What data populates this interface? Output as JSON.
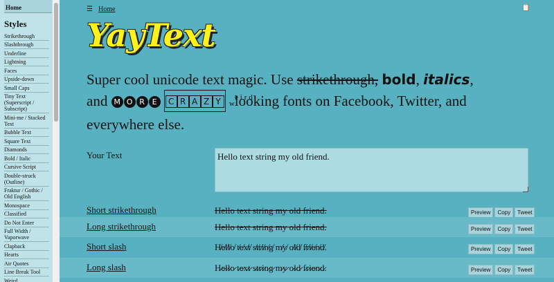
{
  "sidebar": {
    "home": "Home",
    "styles_title": "Styles",
    "items": [
      "Strikethrough",
      "Slashthrough",
      "Underline",
      "Lightning",
      "Faces",
      "Upside-down",
      "Small Caps",
      "Tiny Text (Superscript / Subscript)",
      "Mini-me / Stacked Text",
      "Bubble Text",
      "Square Text",
      "Diamonds",
      "Bold / Italic",
      "Cursive Script",
      "Double-struck (Outline)",
      "Fraktur / Gothic / Old English",
      "Monospace",
      "Classified",
      "Do Not Enter",
      "Full Width / Vaporwave",
      "Clapback",
      "Hearts",
      "Air Quotes",
      "Line Break Tool",
      "Weird"
    ]
  },
  "header": {
    "menu_icon": "☰",
    "breadcrumb": "Home",
    "clipboard_icon": "📋"
  },
  "logo": "YayText",
  "tagline": {
    "p1": "Super cool unicode text magic. Use ",
    "strike": "strikethrough,",
    "bold": "bold",
    "comma": ",",
    "italic": "italics",
    "comma2": ",",
    "and": "and ",
    "more": [
      "M",
      "O",
      "R",
      "E"
    ],
    "crazy": [
      "C",
      "R",
      "A",
      "Z",
      "Y"
    ],
    "weird_w": "w",
    "weird_up": "eird",
    "p2": "looking fonts on Facebook, Twitter, and everywhere else."
  },
  "input": {
    "label": "Your Text",
    "value": "Hello text string my old friend."
  },
  "buttons": {
    "preview": "Preview",
    "copy": "Copy",
    "tweet": "Tweet"
  },
  "rows": [
    {
      "label": "Short strikethrough",
      "output": "Hello text string my old friend."
    },
    {
      "label": "Long strikethrough",
      "output": "Hello text string my old friend."
    },
    {
      "label": "Short slash",
      "output": "H̸e̸l̸l̸o̸ t̸e̸x̸t̸ s̸t̸r̸i̸n̸g̸ m̸y̸ o̸l̸d̸ f̸r̸i̸e̸n̸d̸."
    },
    {
      "label": "Long slash",
      "output": "H̷e̷l̷l̷o̷ t̷e̷x̷t̷ s̷t̷r̷i̷n̷g̷ m̷y̷ o̷l̷d̷ f̷r̷i̷e̷n̷d̷."
    }
  ],
  "colors": {
    "background": "#57b1c1",
    "sidebar": "#bfe3e8",
    "logo": "#fff11a",
    "row_alt": "#69bac8"
  }
}
